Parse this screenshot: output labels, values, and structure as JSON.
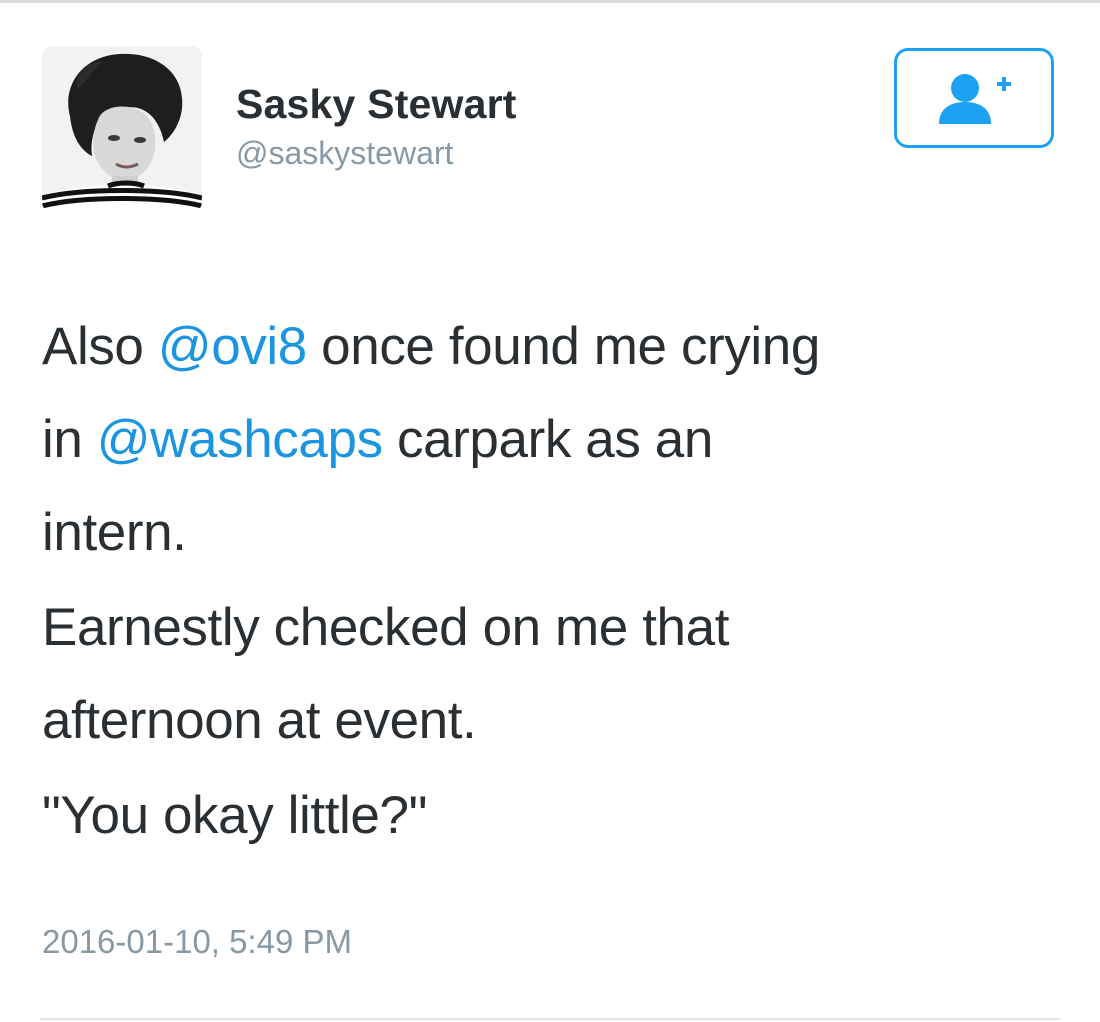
{
  "tweet": {
    "author": {
      "display_name": "Sasky Stewart",
      "screen_name": "@saskystewart",
      "avatar_icon": "avatar-photo"
    },
    "follow_button": {
      "icon": "follow-user-icon",
      "accent_color": "#1da1f2"
    },
    "text": {
      "p1_l1_a": "Also ",
      "p1_l1_mention": "@ovi8",
      "p1_l1_b": " once found me crying",
      "p1_l2_a": "in ",
      "p1_l2_mention": "@washcaps",
      "p1_l2_b": " carpark as an",
      "p1_l3": "intern.",
      "p2_l1": "Earnestly checked on me that",
      "p2_l2": "afternoon at event.",
      "p3_l1": "\"You okay little?\""
    },
    "timestamp": "2016-01-10, 5:49 PM"
  },
  "colors": {
    "text": "#292f33",
    "secondary": "#8899a6",
    "mention": "#1b95e0"
  }
}
